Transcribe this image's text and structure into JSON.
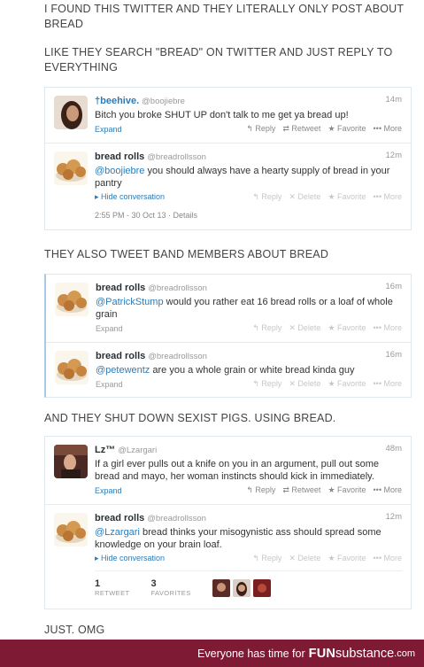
{
  "captions": [
    "I FOUND THIS TWITTER AND THEY LITERALLY ONLY POST ABOUT BREAD",
    "LIKE THEY SEARCH \"BREAD\" ON TWITTER AND JUST REPLY TO EVERYTHING",
    "THEY ALSO TWEET BAND MEMBERS ABOUT BREAD",
    "AND THEY SHUT DOWN SEXIST PIGS. USING BREAD.",
    "JUST. OMG"
  ],
  "thread1": {
    "tweet1": {
      "name": "†beehive.",
      "handle": "@boojiebre",
      "time": "14m",
      "text": "Bitch you broke SHUT UP don't talk to me get ya bread up!",
      "expand": "Expand",
      "actions": [
        "↰ Reply",
        "⇄ Retweet",
        "★ Favorite",
        "••• More"
      ]
    },
    "tweet2": {
      "name": "bread rolls",
      "handle": "@breadrollsson",
      "time": "12m",
      "mention": "@boojiebre",
      "text": " you should always have a hearty supply of bread in your pantry",
      "hide": "▸ Hide conversation",
      "actions": [
        "↰ Reply",
        "✕ Delete",
        "★ Favorite",
        "••• More"
      ],
      "meta": "2:55 PM - 30 Oct 13 · Details"
    }
  },
  "thread2": {
    "tweet1": {
      "name": "bread rolls",
      "handle": "@breadrollsson",
      "time": "16m",
      "mention": "@PatrickStump",
      "text": " would you rather eat 16 bread rolls or a loaf of whole grain",
      "expand": "Expand",
      "actions": [
        "↰ Reply",
        "✕ Delete",
        "★ Favorite",
        "••• More"
      ]
    },
    "tweet2": {
      "name": "bread rolls",
      "handle": "@breadrollsson",
      "time": "16m",
      "mention": "@petewentz",
      "text": " are you a whole grain or white bread kinda guy",
      "expand": "Expand",
      "actions": [
        "↰ Reply",
        "✕ Delete",
        "★ Favorite",
        "••• More"
      ]
    }
  },
  "thread3": {
    "tweet1": {
      "name": "Lz™",
      "handle": "@Lzargari",
      "time": "48m",
      "text": "If a girl ever pulls out a knife on you in an argument, pull out some bread and mayo, her woman instincts should kick in immediately.",
      "expand": "Expand",
      "actions": [
        "↰ Reply",
        "⇄ Retweet",
        "★ Favorite",
        "••• More"
      ]
    },
    "tweet2": {
      "name": "bread rolls",
      "handle": "@breadrollsson",
      "time": "12m",
      "mention": "@Lzargari",
      "text": " bread thinks your misogynistic ass should spread some knowledge on your brain loaf.",
      "hide": "▸ Hide conversation",
      "actions": [
        "↰ Reply",
        "✕ Delete",
        "★ Favorite",
        "••• More"
      ],
      "retweets": "1",
      "retweets_label": "RETWEET",
      "favorites": "3",
      "favorites_label": "FAVORITES"
    }
  },
  "footer": {
    "tagline": "Everyone has time for",
    "brand_fun": "FUN",
    "brand_sub": "substance",
    "brand_com": ".com"
  },
  "colors": {
    "link": "#2b7bb9",
    "footer_bg": "#7e1a33"
  }
}
